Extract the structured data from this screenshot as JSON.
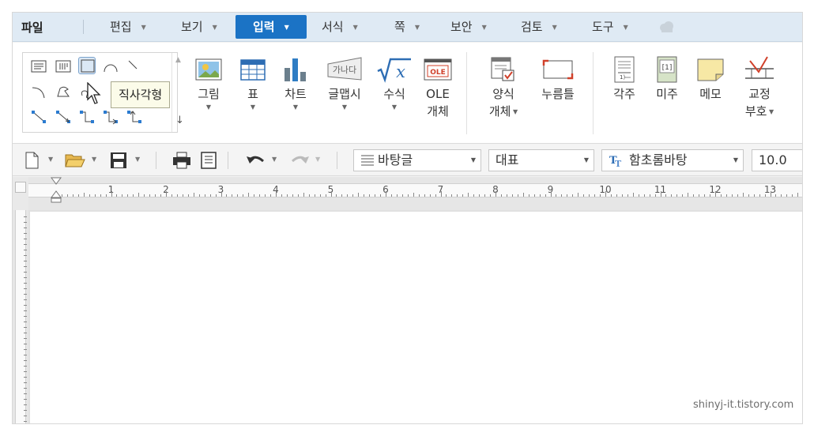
{
  "menu": {
    "file": "파일",
    "items": [
      {
        "label": "편집",
        "active": false
      },
      {
        "label": "보기",
        "active": false
      },
      {
        "label": "입력",
        "active": true
      },
      {
        "label": "서식",
        "active": false
      },
      {
        "label": "쪽",
        "active": false
      },
      {
        "label": "보안",
        "active": false
      },
      {
        "label": "검토",
        "active": false
      },
      {
        "label": "도구",
        "active": false
      }
    ]
  },
  "shapes": {
    "tooltip": "직사각형"
  },
  "ribbon": {
    "picture": "그림",
    "table": "표",
    "chart": "차트",
    "glyph": "글맵시",
    "equation": "수식",
    "ole_line1": "OLE",
    "ole_line2": "개체",
    "ole_icon_text": "OLE",
    "glyph_icon_text": "가나다",
    "form_line1": "양식",
    "form_line2": "개체",
    "press_frame": "누름틀",
    "footnote": "각주",
    "endnote": "미주",
    "memo": "메모",
    "proof_line1": "교정",
    "proof_line2": "부호",
    "endnote_icon_text": "[1]"
  },
  "toolbar": {
    "style": "바탕글",
    "outline": "대표",
    "font": "함초롬바탕",
    "size": "10.0"
  },
  "ruler": {
    "numbers": [
      "1",
      "2",
      "3",
      "4",
      "5",
      "6",
      "7",
      "8",
      "9",
      "10",
      "11",
      "12",
      "13"
    ]
  },
  "watermark": "shinyj-it.tistory.com",
  "colors": {
    "accent": "#1b73c5",
    "menubar": "#dfeaf4"
  }
}
